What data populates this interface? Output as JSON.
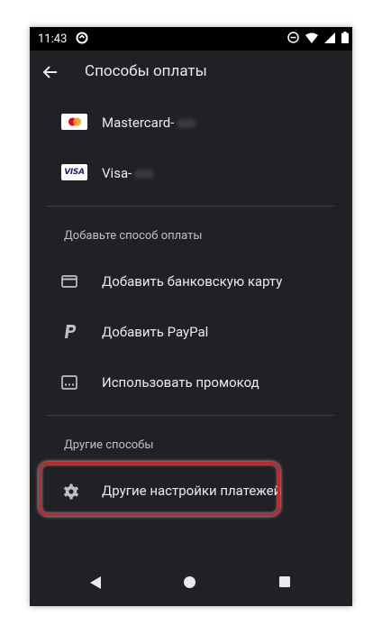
{
  "status_bar": {
    "time": "11:43"
  },
  "app_bar": {
    "title": "Способы оплаты"
  },
  "saved_cards": [
    {
      "icon": "mastercard-icon",
      "label": "Mastercard-"
    },
    {
      "icon": "visa-icon",
      "label": "Visa-",
      "badge_text": "VISA"
    }
  ],
  "add_section": {
    "title": "Добавьте способ оплаты",
    "items": [
      {
        "icon": "credit-card-icon",
        "label": "Добавить банковскую карту"
      },
      {
        "icon": "paypal-icon",
        "label": "Добавить PayPal"
      },
      {
        "icon": "promo-code-icon",
        "label": "Использовать промокод"
      }
    ]
  },
  "other_section": {
    "title": "Другие способы",
    "items": [
      {
        "icon": "gear-icon",
        "label": "Другие настройки платежей"
      }
    ]
  },
  "colors": {
    "background": "#202124",
    "text": "#e8eaed",
    "highlight": "#c8232c"
  }
}
